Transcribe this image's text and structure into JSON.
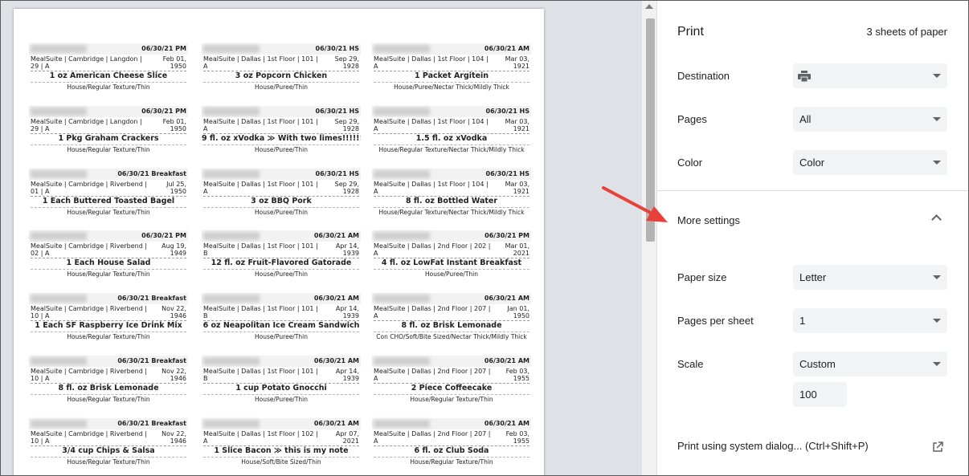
{
  "panel": {
    "title": "Print",
    "sheet_count": "3 sheets of paper",
    "destination": {
      "label": "Destination",
      "icon": "printer-icon"
    },
    "pages": {
      "label": "Pages",
      "value": "All"
    },
    "color": {
      "label": "Color",
      "value": "Color"
    },
    "more_settings": "More settings",
    "paper_size": {
      "label": "Paper size",
      "value": "Letter"
    },
    "pages_per_sheet": {
      "label": "Pages per sheet",
      "value": "1"
    },
    "scale": {
      "label": "Scale",
      "value": "Custom",
      "custom_value": "100"
    },
    "system_dialog": "Print using system dialog... (Ctrl+Shift+P)"
  },
  "labels": [
    {
      "meal": "06/30/21 PM",
      "loc": "MealSuite | Cambridge | Langdon | 29 | A",
      "dob": "Feb 01, 1950",
      "item": "1 oz American Cheese Slice",
      "texture": "House/Regular Texture/Thin"
    },
    {
      "meal": "06/30/21 HS",
      "loc": "MealSuite | Dallas | 1st Floor | 101 | A",
      "dob": "Sep 29, 1928",
      "item": "3 oz Popcorn Chicken",
      "texture": "House/Puree/Thin"
    },
    {
      "meal": "06/30/21 AM",
      "loc": "MealSuite | Dallas | 1st Floor | 104 | A",
      "dob": "Mar 03, 1921",
      "item": "1 Packet Argitein",
      "texture": "House/Puree/Nectar Thick/Mildly Thick"
    },
    {
      "meal": "06/30/21 PM",
      "loc": "MealSuite | Cambridge | Langdon | 29 | A",
      "dob": "Feb 01, 1950",
      "item": "1 Pkg Graham Crackers",
      "texture": "House/Regular Texture/Thin"
    },
    {
      "meal": "06/30/21 HS",
      "loc": "MealSuite | Dallas | 1st Floor | 101 | A",
      "dob": "Sep 29, 1928",
      "item": "9 fl. oz xVodka ≫ With two limes!!!!!!!!!",
      "texture": "House/Puree/Thin"
    },
    {
      "meal": "06/30/21 HS",
      "loc": "MealSuite | Dallas | 1st Floor | 104 | A",
      "dob": "Mar 03, 1921",
      "item": "1.5 fl. oz xVodka",
      "texture": "House/Regular Texture/Nectar Thick/Mildly Thick"
    },
    {
      "meal": "06/30/21 Breakfast",
      "loc": "MealSuite | Cambridge | Riverbend | 01 | A",
      "dob": "Jul 25, 1950",
      "item": "1 Each Buttered Toasted Bagel",
      "texture": "House/Regular Texture/Thin"
    },
    {
      "meal": "06/30/21 HS",
      "loc": "MealSuite | Dallas | 1st Floor | 101 | A",
      "dob": "Sep 29, 1928",
      "item": "3 oz BBQ Pork",
      "texture": "House/Puree/Thin"
    },
    {
      "meal": "06/30/21 HS",
      "loc": "MealSuite | Dallas | 1st Floor | 104 | A",
      "dob": "Mar 03, 1921",
      "item": "8 fl. oz Bottled Water",
      "texture": "House/Regular Texture/Nectar Thick/Mildly Thick"
    },
    {
      "meal": "06/30/21 PM",
      "loc": "MealSuite | Cambridge | Riverbend | 02 | A",
      "dob": "Aug 19, 1949",
      "item": "1 Each House Salad",
      "texture": "House/Regular Texture/Thin"
    },
    {
      "meal": "06/30/21 AM",
      "loc": "MealSuite | Dallas | 1st Floor | 101 | B",
      "dob": "Apr 14, 1939",
      "item": "12 fl. oz Fruit-Flavored Gatorade",
      "texture": "House/Puree/Thin"
    },
    {
      "meal": "06/30/21 PM",
      "loc": "MealSuite | Dallas | 2nd Floor | 202 | A",
      "dob": "Mar 01, 2021",
      "item": "4 fl. oz LowFat Instant Breakfast",
      "texture": "House/Puree/Thin"
    },
    {
      "meal": "06/30/21 Breakfast",
      "loc": "MealSuite | Cambridge | Riverbend | 10 | A",
      "dob": "Nov 22, 1946",
      "item": "1 Each SF Raspberry Ice Drink Mix",
      "texture": "House/Regular Texture/Thin"
    },
    {
      "meal": "06/30/21 AM",
      "loc": "MealSuite | Dallas | 1st Floor | 101 | B",
      "dob": "Apr 14, 1939",
      "item": "6 oz Neapolitan Ice Cream Sandwich",
      "texture": "House/Puree/Thin"
    },
    {
      "meal": "06/30/21 AM",
      "loc": "MealSuite | Dallas | 2nd Floor | 207 | A",
      "dob": "Jan 01, 1950",
      "item": "8 fl. oz Brisk Lemonade",
      "texture": "Con CHO/Soft/Bite Sized/Nectar Thick/Mildly Thick"
    },
    {
      "meal": "06/30/21 Breakfast",
      "loc": "MealSuite | Cambridge | Riverbend | 10 | A",
      "dob": "Nov 22, 1946",
      "item": "8 fl. oz Brisk Lemonade",
      "texture": "House/Regular Texture/Thin"
    },
    {
      "meal": "06/30/21 AM",
      "loc": "MealSuite | Dallas | 1st Floor | 101 | B",
      "dob": "Apr 14, 1939",
      "item": "1 cup Potato Gnocchi",
      "texture": "House/Puree/Thin"
    },
    {
      "meal": "06/30/21 AM",
      "loc": "MealSuite | Dallas | 2nd Floor | 207 | A",
      "dob": "Feb 03, 1955",
      "item": "2 Piece Coffeecake",
      "texture": "House/Regular Texture/Thin"
    },
    {
      "meal": "06/30/21 Breakfast",
      "loc": "MealSuite | Cambridge | Riverbend | 10 | A",
      "dob": "Nov 22, 1946",
      "item": "3/4 cup Chips & Salsa",
      "texture": "House/Regular Texture/Thin"
    },
    {
      "meal": "06/30/21 AM",
      "loc": "MealSuite | Dallas | 1st Floor | 102 | A",
      "dob": "Apr 07, 2021",
      "item": "1 Slice Bacon ≫ this is my note",
      "texture": "House/Soft/Bite Sized/Thin"
    },
    {
      "meal": "06/30/21 AM",
      "loc": "MealSuite | Dallas | 2nd Floor | 207 | A",
      "dob": "Feb 03, 1955",
      "item": "6 fl. oz Club Soda",
      "texture": "House/Regular Texture/Thin"
    }
  ],
  "annotation": {
    "color": "#e8403a"
  }
}
